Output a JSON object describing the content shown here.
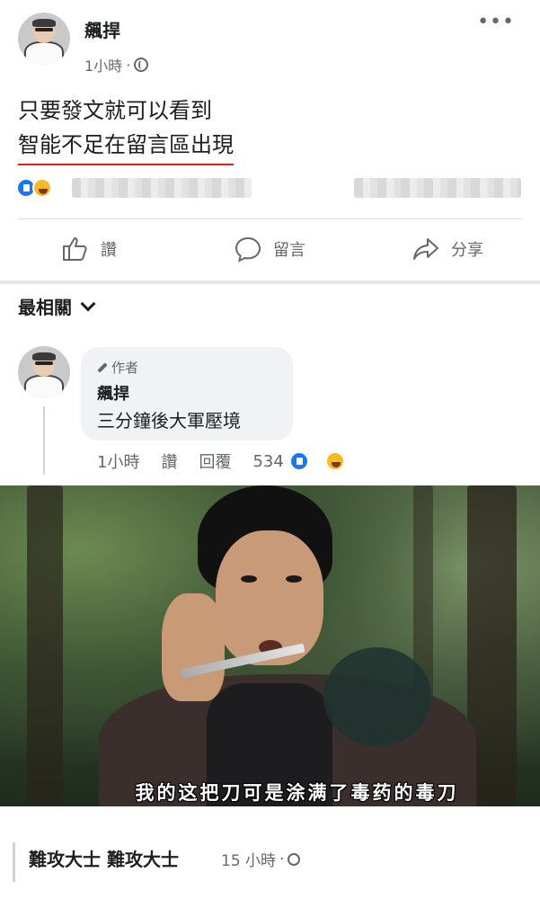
{
  "post": {
    "author": "飆捍",
    "time": "1小時",
    "separator": "·",
    "text_line1": "只要發文就可以看到",
    "text_line2": "智能不足在留言區出現"
  },
  "actions": {
    "like": "讚",
    "comment": "留言",
    "share": "分享"
  },
  "sort": {
    "label": "最相關"
  },
  "comment": {
    "author_tag": "作者",
    "author": "飆捍",
    "text": "三分鐘後大軍壓境",
    "time": "1小時",
    "like": "讚",
    "reply": "回覆",
    "reaction_count": "534"
  },
  "image": {
    "subtitle": "我的这把刀可是涂满了毒药的毒刀"
  },
  "footer_comment": {
    "names": "難攻大士 難攻大士",
    "time": "15 小時",
    "separator": "·"
  },
  "colors": {
    "accent": "#1877f2",
    "haha": "#f7b928",
    "underline": "#e02020",
    "meta": "#65676b"
  }
}
